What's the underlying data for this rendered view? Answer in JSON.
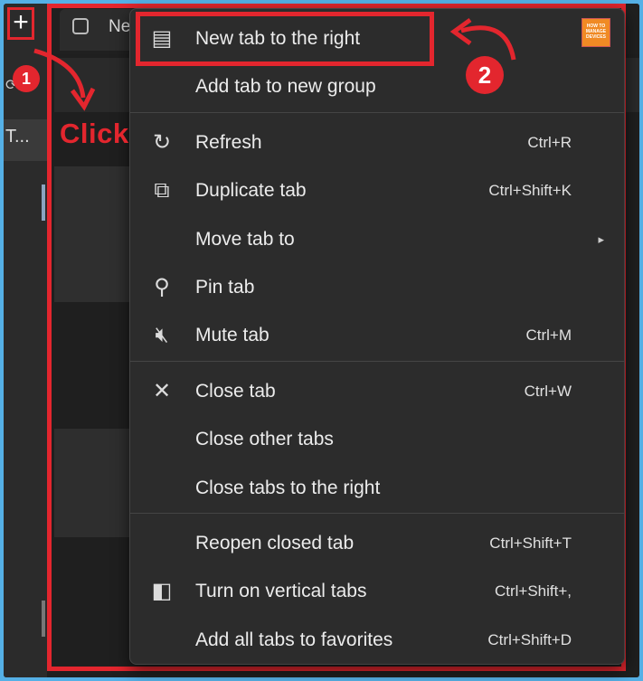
{
  "browser": {
    "tab_title": "Ne",
    "vertical_tab_text": "T..."
  },
  "context_menu": {
    "groups": [
      [
        {
          "icon": "new-tab-icon",
          "label": "New tab to the right",
          "shortcut": ""
        },
        {
          "icon": "",
          "label": "Add tab to new group",
          "shortcut": ""
        }
      ],
      [
        {
          "icon": "refresh-icon",
          "label": "Refresh",
          "shortcut": "Ctrl+R"
        },
        {
          "icon": "duplicate-icon",
          "label": "Duplicate tab",
          "shortcut": "Ctrl+Shift+K"
        },
        {
          "icon": "",
          "label": "Move tab to",
          "shortcut": "",
          "submenu": true
        },
        {
          "icon": "pin-icon",
          "label": "Pin tab",
          "shortcut": ""
        },
        {
          "icon": "mute-icon",
          "label": "Mute tab",
          "shortcut": "Ctrl+M"
        }
      ],
      [
        {
          "icon": "close-icon",
          "label": "Close tab",
          "shortcut": "Ctrl+W"
        },
        {
          "icon": "",
          "label": "Close other tabs",
          "shortcut": ""
        },
        {
          "icon": "",
          "label": "Close tabs to the right",
          "shortcut": ""
        }
      ],
      [
        {
          "icon": "",
          "label": "Reopen closed tab",
          "shortcut": "Ctrl+Shift+T"
        },
        {
          "icon": "vertical-tabs-icon",
          "label": "Turn on vertical tabs",
          "shortcut": "Ctrl+Shift+,"
        },
        {
          "icon": "",
          "label": "Add all tabs to favorites",
          "shortcut": "Ctrl+Shift+D"
        }
      ]
    ]
  },
  "annotations": {
    "step1": "1",
    "step2": "2",
    "click_label": "Click",
    "accent_color": "#e3262e"
  },
  "logo": {
    "lines": [
      "HOW TO",
      "MANAGE",
      "DEVICES"
    ]
  }
}
